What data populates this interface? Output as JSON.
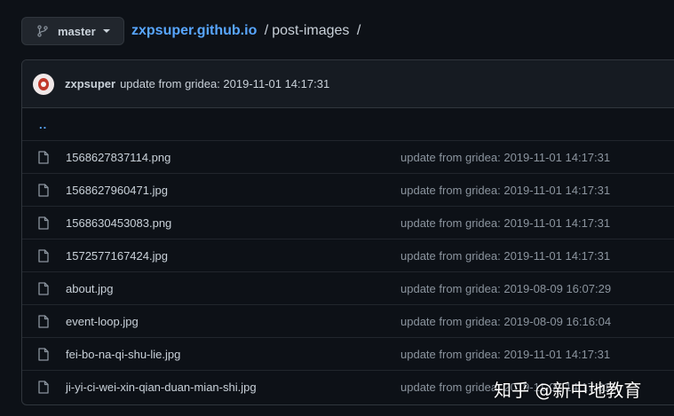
{
  "branch": {
    "icon": "git-branch-icon",
    "label": "master"
  },
  "breadcrumb": {
    "repo": "zxpsuper.github.io",
    "separator": "/",
    "current": "post-images",
    "trailing": "/"
  },
  "commit": {
    "author": "zxpsuper",
    "message": "update from gridea: 2019-11-01 14:17:31"
  },
  "up_link": "..",
  "files": [
    {
      "name": "1568627837114.png",
      "commit": "update from gridea: 2019-11-01 14:17:31"
    },
    {
      "name": "1568627960471.jpg",
      "commit": "update from gridea: 2019-11-01 14:17:31"
    },
    {
      "name": "1568630453083.png",
      "commit": "update from gridea: 2019-11-01 14:17:31"
    },
    {
      "name": "1572577167424.jpg",
      "commit": "update from gridea: 2019-11-01 14:17:31"
    },
    {
      "name": "about.jpg",
      "commit": "update from gridea: 2019-08-09 16:07:29"
    },
    {
      "name": "event-loop.jpg",
      "commit": "update from gridea: 2019-08-09 16:16:04"
    },
    {
      "name": "fei-bo-na-qi-shu-lie.jpg",
      "commit": "update from gridea: 2019-11-01 14:17:31"
    },
    {
      "name": "ji-yi-ci-wei-xin-qian-duan-mian-shi.jpg",
      "commit": "update from gridea: 2019-11-01 14:17:31"
    }
  ],
  "watermark": "知乎 @新中地教育",
  "colors": {
    "background": "#0d1117",
    "link": "#58a6ff",
    "text": "#c9d1d9",
    "muted": "#8b949e",
    "border": "#30363d"
  }
}
